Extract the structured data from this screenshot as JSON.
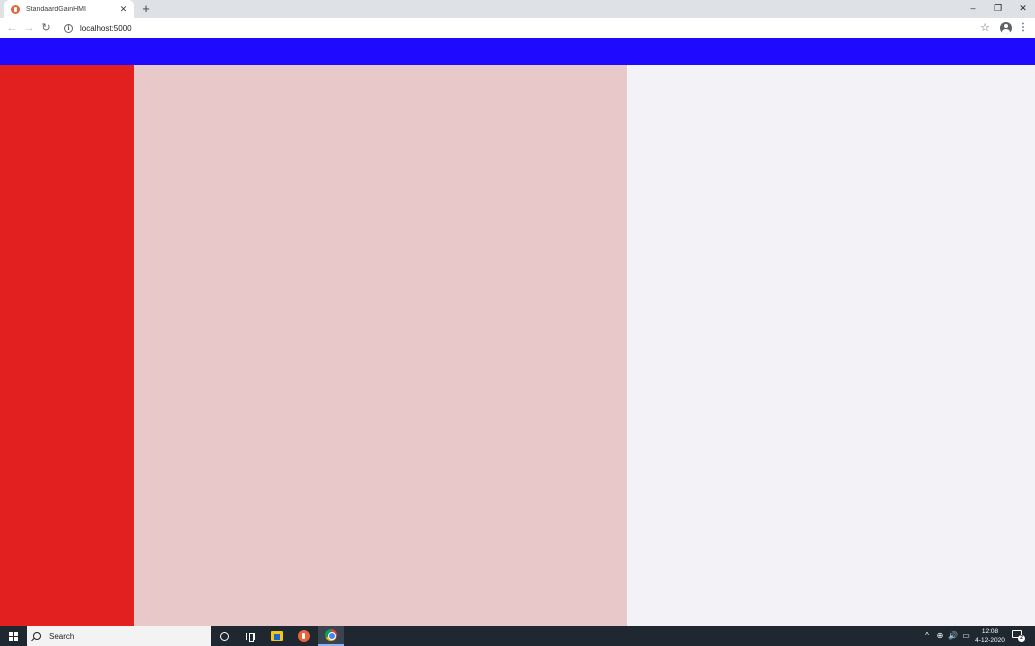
{
  "browser": {
    "tab": {
      "title": "StandaardGainHMI",
      "favicon": "app-favicon-icon",
      "close_glyph": "✕"
    },
    "new_tab_glyph": "+",
    "window_controls": {
      "minimize": "–",
      "restore": "❐",
      "close": "✕"
    },
    "nav": {
      "back": "←",
      "forward": "→",
      "reload": "↻"
    },
    "address_bar": {
      "url": "localhost:5000",
      "info_glyph": "i"
    },
    "star_glyph": "☆",
    "menu_glyph": "⋮"
  },
  "page": {
    "colors": {
      "header": "#2009ff",
      "sidebar": "#e32020",
      "main_panel": "#e8c8c9",
      "right_panel": "#f3f3f7"
    }
  },
  "taskbar": {
    "search_label": "Search",
    "tray": {
      "chevron": "^",
      "volume": "🔊"
    },
    "clock": {
      "time": "12:08",
      "date": "4-12-2020"
    },
    "notification_count": "2"
  }
}
